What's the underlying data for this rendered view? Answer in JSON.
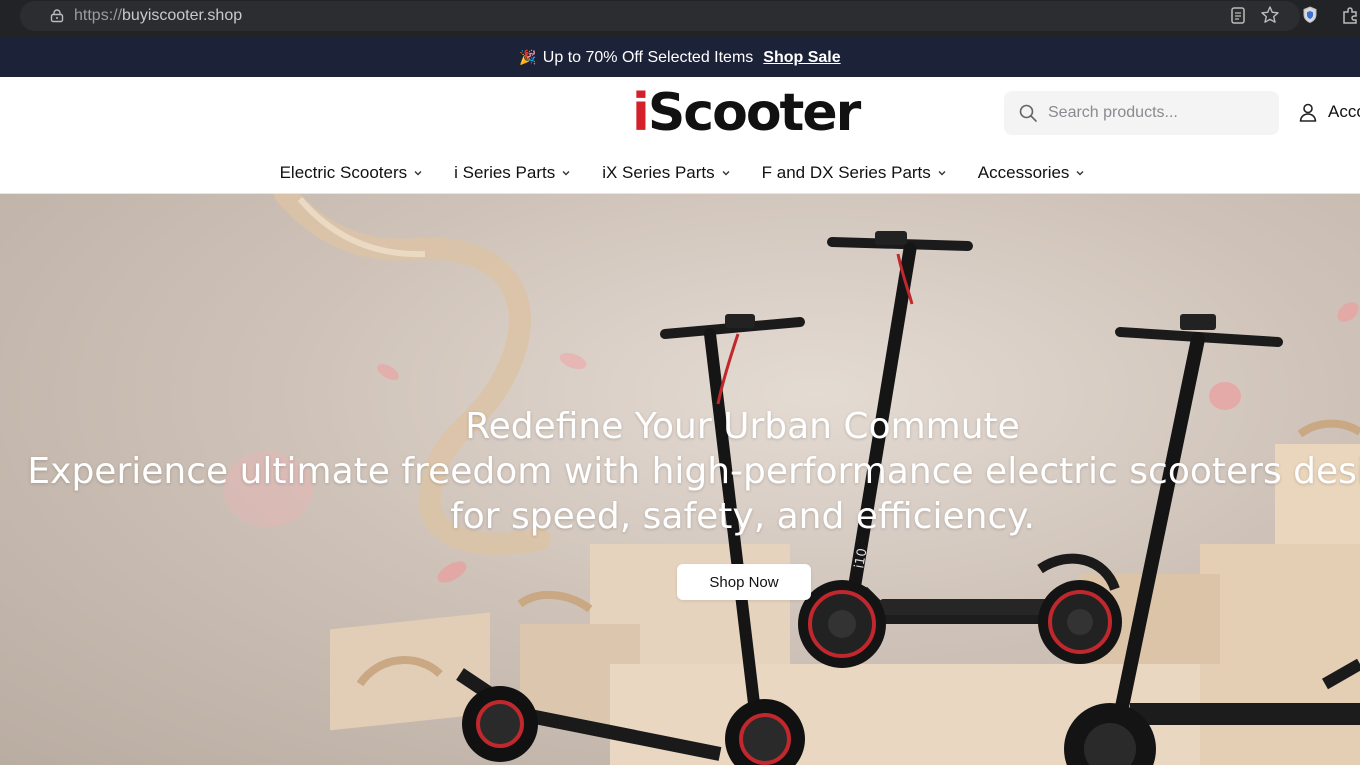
{
  "browser": {
    "url_protocol": "https://",
    "url_host": "buyiscooter.shop"
  },
  "announcement": {
    "icon": "party-popper-icon",
    "text": "Up to 70% Off Selected Items",
    "link": "Shop Sale"
  },
  "header": {
    "logo": "iScooter",
    "search_placeholder": "Search products...",
    "account_label": "Acco"
  },
  "nav": {
    "items": [
      {
        "label": "Electric Scooters"
      },
      {
        "label": "i Series Parts"
      },
      {
        "label": "iX Series Parts"
      },
      {
        "label": "F and DX Series Parts"
      },
      {
        "label": "Accessories"
      }
    ]
  },
  "hero": {
    "title": "Redefine Your Urban Commute",
    "subtitle": "Experience ultimate freedom with high-performance electric scooters designed for speed, safety, and efficiency.",
    "cta": "Shop Now",
    "scooter_deck_label": "i10"
  },
  "colors": {
    "announcement_bg": "#1c2237",
    "brand_red": "#d3202a",
    "hero_bg": "#cfc3b9"
  }
}
